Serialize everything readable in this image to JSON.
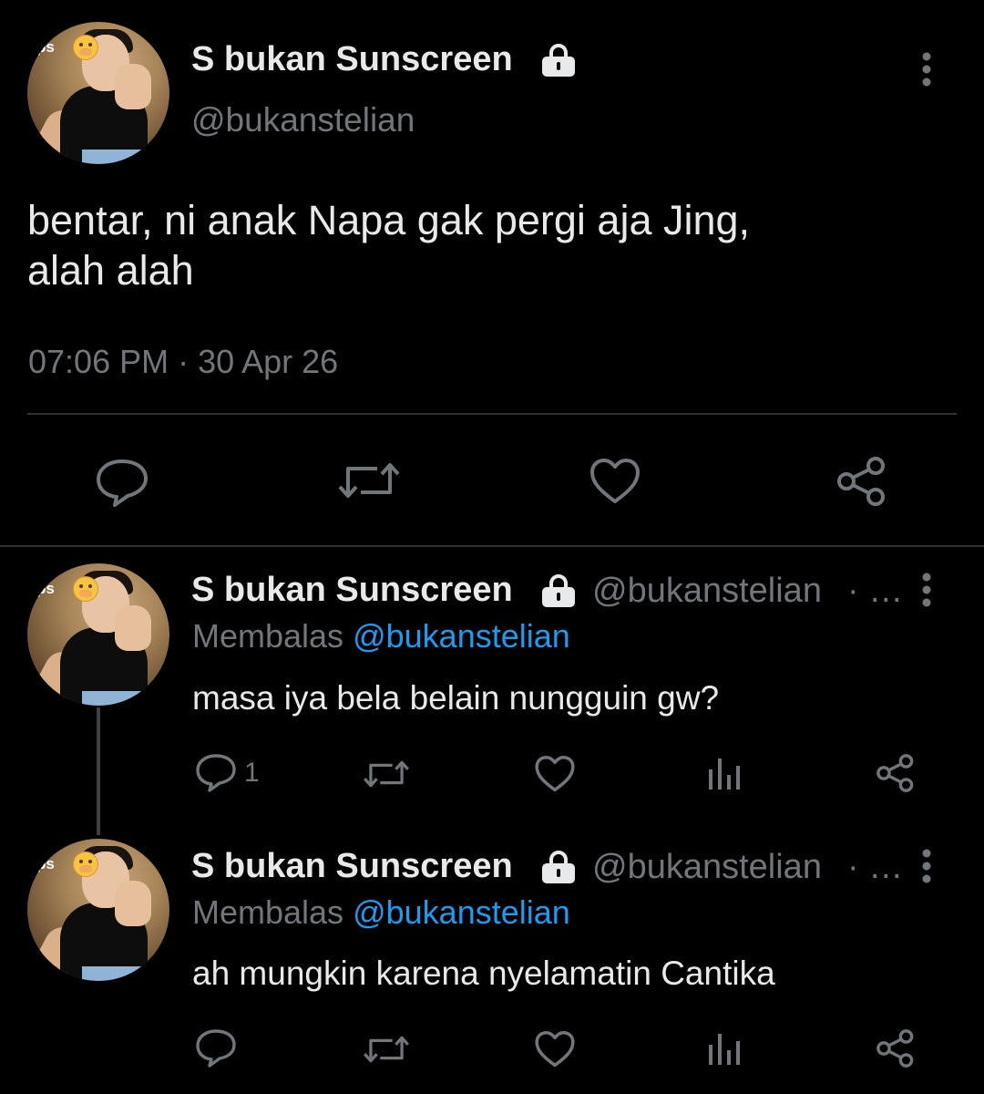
{
  "main_tweet": {
    "display_name": "S bukan Sunscreen",
    "handle": "@bukanstelian",
    "text_line1": "bentar, ni anak Napa gak pergi aja Jing,",
    "text_line2": "alah alah",
    "timestamp": "07:06 PM · 30 Apr 26",
    "avatar_badge": "ps"
  },
  "replies": [
    {
      "display_name": "S bukan Sunscreen",
      "handle": "@bukanstelian",
      "separator": "· …",
      "replying_prefix": "Membalas",
      "replying_to": "@bukanstelian",
      "text": "masa iya bela belain nungguin gw?",
      "reply_count": "1",
      "avatar_badge": "ps"
    },
    {
      "display_name": "S bukan Sunscreen",
      "handle": "@bukanstelian",
      "separator": "· …",
      "replying_prefix": "Membalas",
      "replying_to": "@bukanstelian",
      "text": "ah mungkin karena nyelamatin Cantika",
      "reply_count": "",
      "avatar_badge": "ps"
    }
  ],
  "icons": {
    "reply": "reply-icon",
    "retweet": "retweet-icon",
    "like": "heart-icon",
    "share": "share-icon",
    "views": "views-icon",
    "lock": "lock-icon",
    "more": "more-vertical-icon"
  },
  "colors": {
    "background": "#000000",
    "text": "#e7e9ea",
    "secondary": "#71767b",
    "link": "#1d9bf0",
    "divider": "#2f3336"
  }
}
